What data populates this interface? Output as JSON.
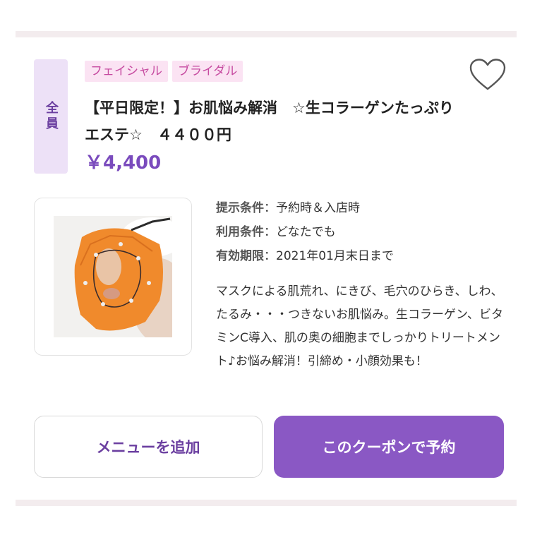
{
  "coupon": {
    "target_badge": "全員",
    "tags": [
      "フェイシャル",
      "ブライダル"
    ],
    "title": "【平日限定！】お肌悩み解消　☆生コラーゲンたっぷりエステ☆　４４００円",
    "price": "￥4,400",
    "conditions": [
      {
        "key": "提示条件",
        "value": "予約時＆入店時"
      },
      {
        "key": "利用条件",
        "value": "どなたでも"
      },
      {
        "key": "有効期限",
        "value": "2021年01月末日まで"
      }
    ],
    "description": "マスクによる肌荒れ、にきび、毛穴のひらき、しわ、たるみ・・・つきないお肌悩み。生コラーゲン、ビタミンC導入、肌の奥の細胞までしっかりトリートメント♪お悩み解消！引締め・小顔効果も！",
    "photo_icon": "facial-mask-treatment-photo",
    "favorite_icon": "heart-icon"
  },
  "actions": {
    "add_menu_label": "メニューを追加",
    "reserve_label": "このクーポンで予約"
  },
  "colors": {
    "accent": "#8a58c4",
    "accent_text": "#6b3fa0",
    "tag_bg": "#fbe3f3",
    "tag_text": "#c64aa0",
    "badge_bg": "#ede1f7",
    "divider": "#f3ecee"
  }
}
